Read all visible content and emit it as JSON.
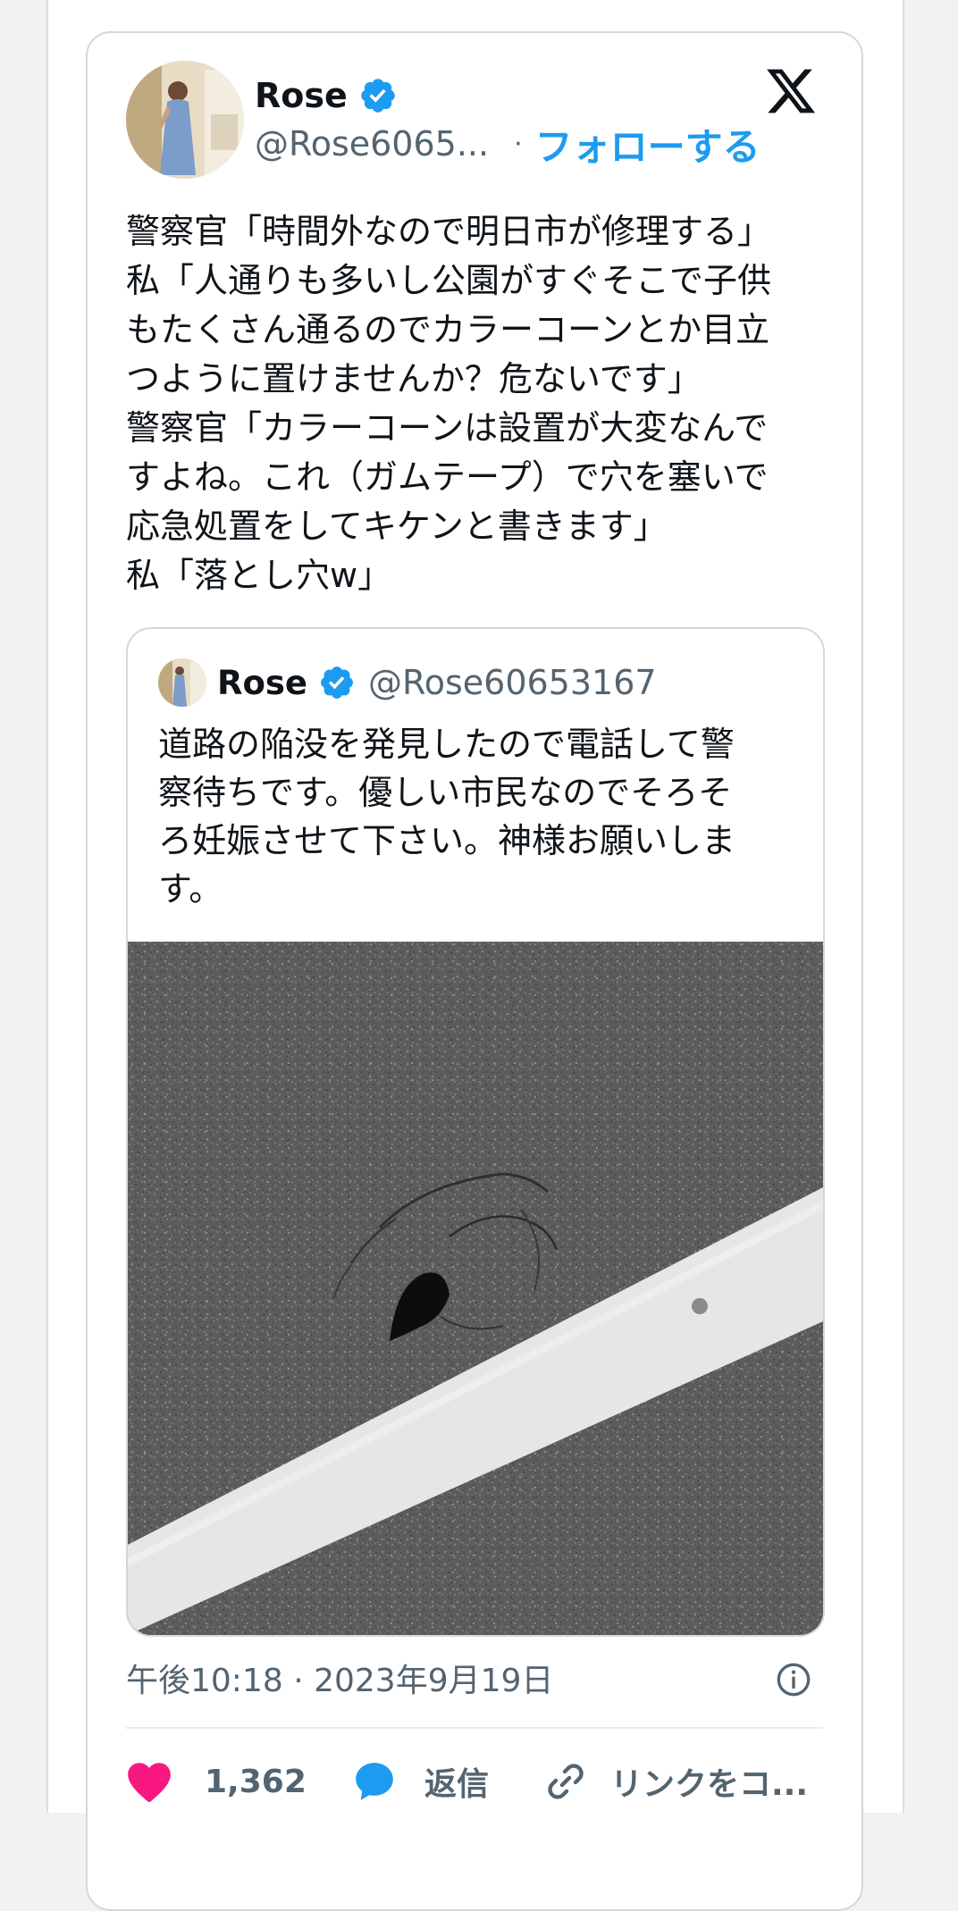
{
  "author": {
    "name": "Rose",
    "handle": "@Rose6065...",
    "follow_label": "フォローする",
    "separator": "·"
  },
  "tweet": {
    "lines": [
      "警察官「時間外なので明日市が修理する」",
      "私「人通りも多いし公園がすぐそこで子供",
      "もたくさん通るのでカラーコーンとか目立",
      "つように置けませんか？危ないです」",
      "警察官「カラーコーンは設置が大変なんで",
      "すよね。これ（ガムテープ）で穴を塞いで",
      "応急処置をしてキケンと書きます」",
      "私「落とし穴w」"
    ]
  },
  "quote": {
    "name": "Rose",
    "handle": "@Rose60653167",
    "lines": [
      "道路の陥没を発見したので電話して警",
      "察待ちです。優しい市民なのでそろそ",
      "ろ妊娠させて下さい。神様お願いしま",
      "す。"
    ]
  },
  "meta": {
    "timestamp": "午後10:18 · 2023年9月19日"
  },
  "actions": {
    "likes": "1,362",
    "reply_label": "返信",
    "copy_link_label": "リンクをコ..."
  },
  "colors": {
    "accent": "#1d9bf0",
    "like": "#f91880",
    "muted": "#536471",
    "verified": "#1d9bf0"
  },
  "icons": [
    "x-logo-icon",
    "verified-badge-icon",
    "info-icon",
    "heart-icon",
    "reply-bubble-icon",
    "link-icon"
  ]
}
